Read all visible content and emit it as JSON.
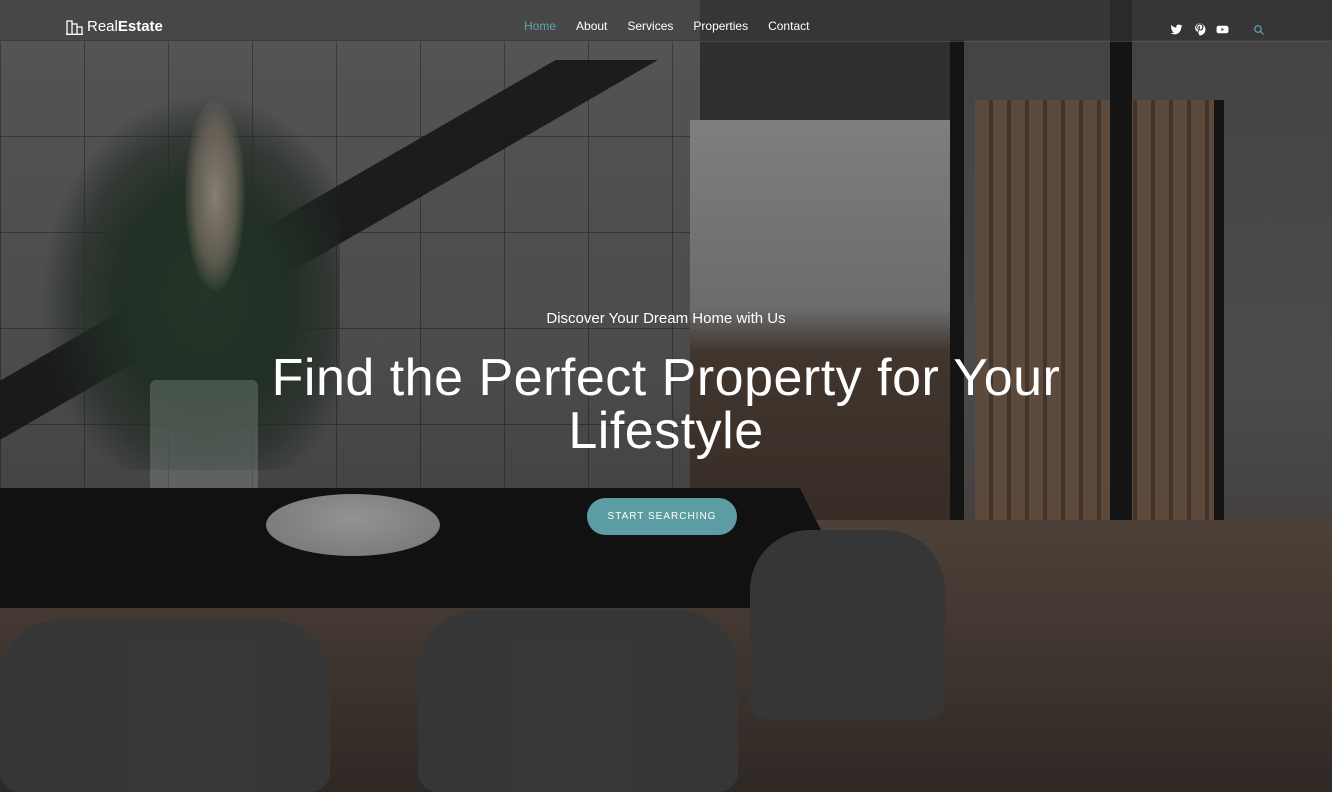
{
  "logo": {
    "light": "Real",
    "bold": "Estate"
  },
  "nav": {
    "items": [
      {
        "label": "Home",
        "active": true
      },
      {
        "label": "About",
        "active": false
      },
      {
        "label": "Services",
        "active": false
      },
      {
        "label": "Properties",
        "active": false
      },
      {
        "label": "Contact",
        "active": false
      }
    ]
  },
  "social": [
    "twitter-icon",
    "pinterest-icon",
    "youtube-icon",
    "search-icon"
  ],
  "hero": {
    "subtitle": "Discover Your Dream Home with Us",
    "title": "Find the Perfect Property for Your Lifestyle",
    "cta_label": "START SEARCHING"
  },
  "colors": {
    "accent": "#5ca7ad",
    "button": "#5b9da2"
  }
}
